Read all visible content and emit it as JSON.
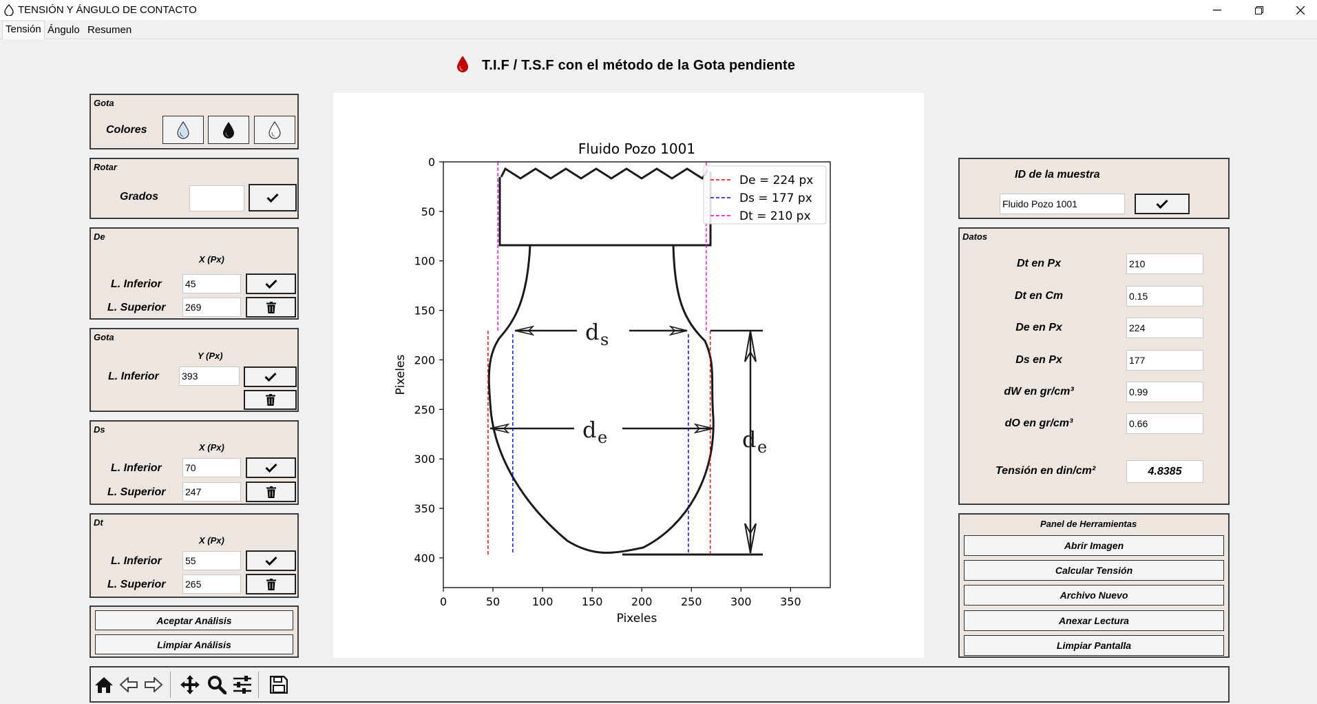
{
  "window": {
    "title": "TENSIÓN Y ÁNGULO DE CONTACTO"
  },
  "tabs": [
    {
      "label": "Tensión"
    },
    {
      "label": "Ángulo"
    },
    {
      "label": "Resumen"
    }
  ],
  "header": {
    "title": "T.I.F / T.S.F con el método de la Gota pendiente",
    "icon": "drop-icon",
    "icon_color": "#c00000"
  },
  "left": {
    "gota_colores": {
      "title": "Gota",
      "label": "Colores"
    },
    "rotar": {
      "title": "Rotar",
      "label": "Grados",
      "value": ""
    },
    "de": {
      "title": "De",
      "axis": "X (Px)",
      "inferior_label": "L. Inferior",
      "inferior_value": "45",
      "superior_label": "L. Superior",
      "superior_value": "269"
    },
    "gota_y": {
      "title": "Gota",
      "axis": "Y (Px)",
      "inferior_label": "L. Inferior",
      "inferior_value": "393"
    },
    "ds": {
      "title": "Ds",
      "axis": "X (Px)",
      "inferior_label": "L. Inferior",
      "inferior_value": "70",
      "superior_label": "L. Superior",
      "superior_value": "247"
    },
    "dt": {
      "title": "Dt",
      "axis": "X (Px)",
      "inferior_label": "L. Inferior",
      "inferior_value": "55",
      "superior_label": "L. Superior",
      "superior_value": "265"
    },
    "actions": {
      "aceptar": "Aceptar Análisis",
      "limpiar": "Limpiar Análisis"
    }
  },
  "right": {
    "id_panel": {
      "title": "ID de la muestra",
      "value": "Fluido Pozo 1001"
    },
    "datos": {
      "title": "Datos",
      "rows": [
        {
          "label": "Dt en Px",
          "value": "210"
        },
        {
          "label": "Dt en Cm",
          "value": "0.15"
        },
        {
          "label": "De en Px",
          "value": "224"
        },
        {
          "label": "Ds en Px",
          "value": "177"
        },
        {
          "label": "dW en gr/cm³",
          "value": "0.99"
        },
        {
          "label": "dO en gr/cm³",
          "value": "0.66"
        }
      ],
      "tension_label": "Tensión en din/cm²",
      "tension_value": "4.8385"
    },
    "herramientas": {
      "title": "Panel de Herramientas",
      "buttons": [
        "Abrir Imagen",
        "Calcular Tensión",
        "Archivo Nuevo",
        "Anexar Lectura",
        "Limpiar Pantalla"
      ]
    }
  },
  "chart_data": {
    "type": "image",
    "title": "Fluido Pozo 1001",
    "xlabel": "Pixeles",
    "ylabel": "Pixeles",
    "xlim": [
      0,
      390
    ],
    "ylim": [
      430,
      0
    ],
    "x_ticks": [
      0,
      50,
      100,
      150,
      200,
      250,
      300,
      350
    ],
    "y_ticks": [
      0,
      50,
      100,
      150,
      200,
      250,
      300,
      350,
      400
    ],
    "legend_position": "top-right",
    "series": [
      {
        "name": "De = 224 px",
        "x": [
          45,
          269
        ],
        "color": "#e00000",
        "style": "dashed"
      },
      {
        "name": "Ds = 177 px",
        "x": [
          70,
          247
        ],
        "color": "#0000d0",
        "style": "dashed"
      },
      {
        "name": "Dt = 210 px",
        "x": [
          55,
          265
        ],
        "color": "#e000e0",
        "style": "dashed"
      }
    ],
    "image_labels": {
      "ds": "d",
      "ds_sub": "s",
      "de": "d",
      "de_sub": "e"
    }
  },
  "toolbar": {
    "icons": [
      "home-icon",
      "back-arrow-icon",
      "forward-arrow-icon",
      "pan-icon",
      "zoom-icon",
      "configure-subplots-icon",
      "save-icon"
    ]
  }
}
